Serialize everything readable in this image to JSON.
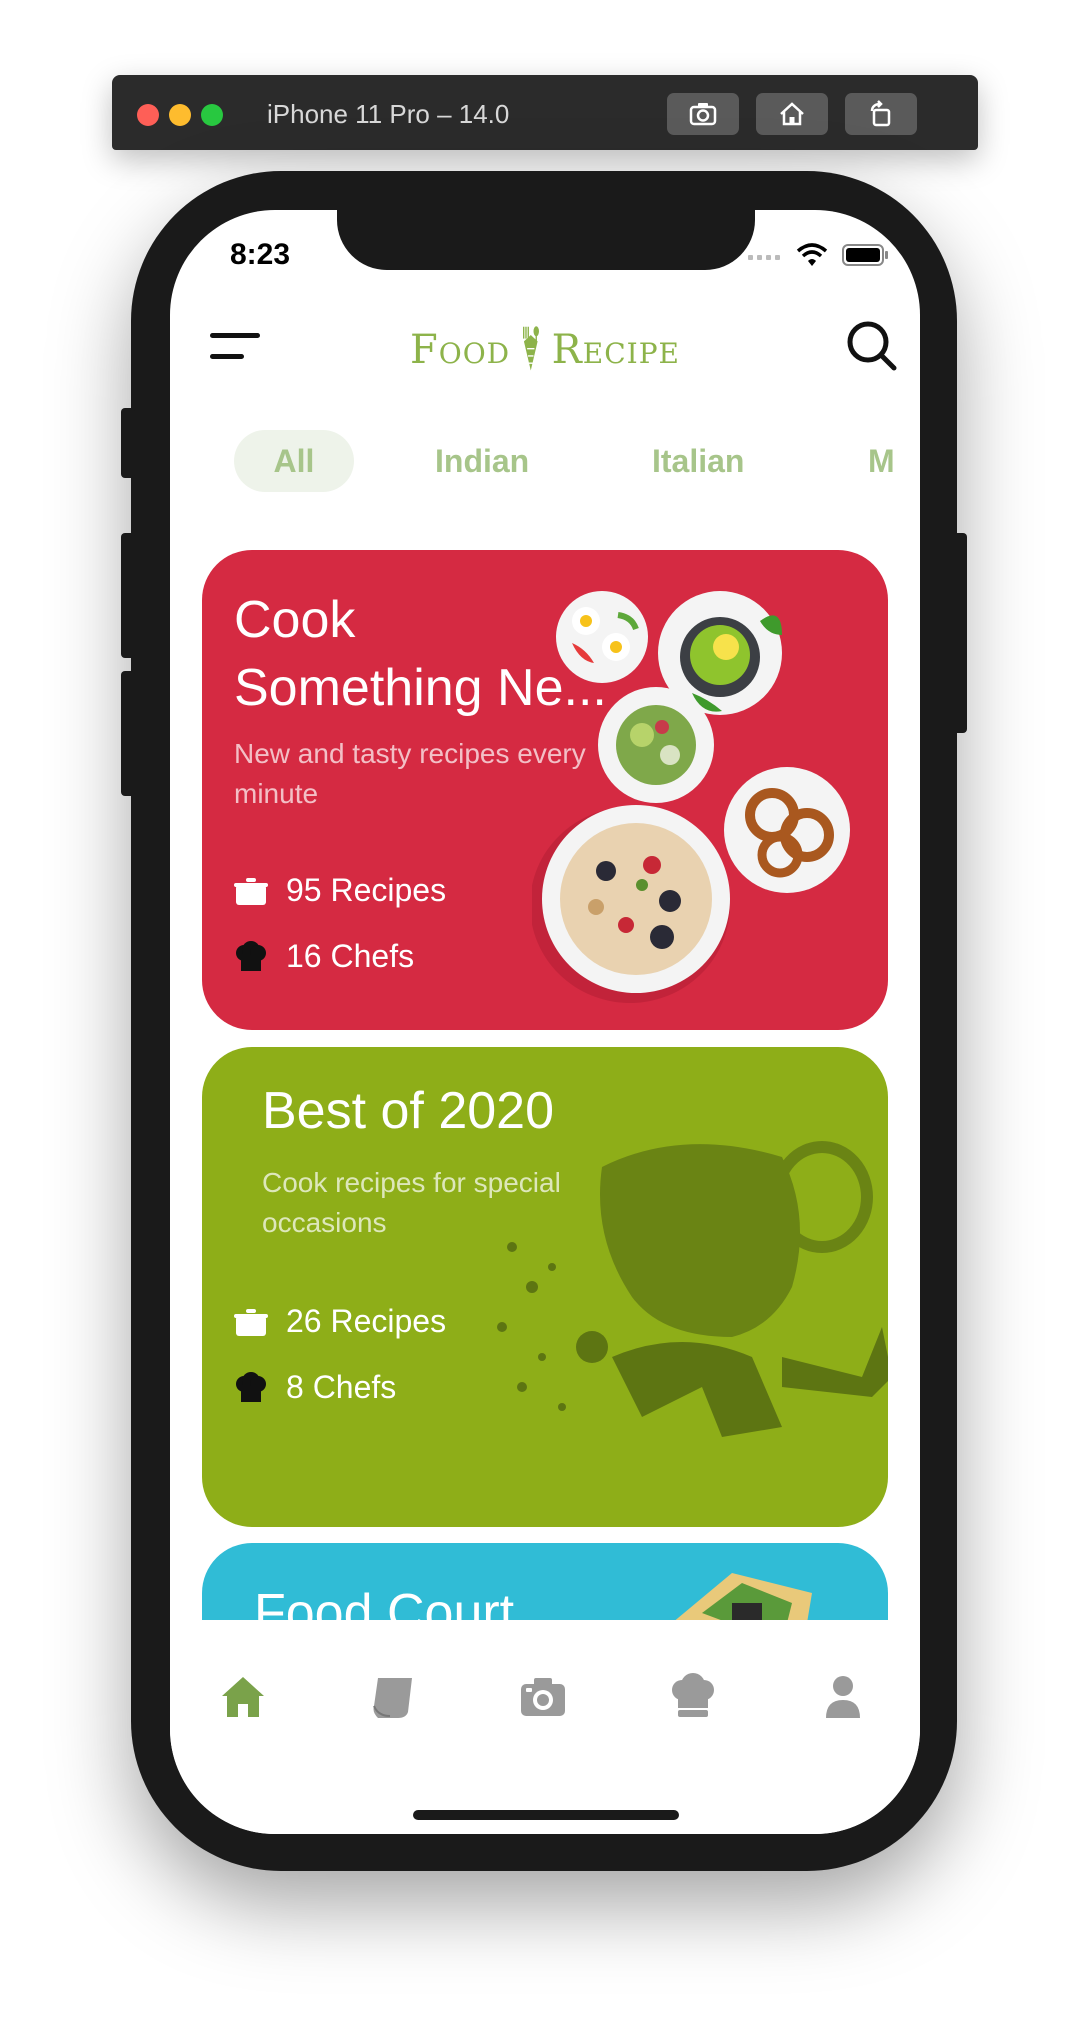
{
  "window": {
    "title": "iPhone 11 Pro – 14.0",
    "buttons": [
      "screenshot-icon",
      "home-icon",
      "rotate-icon"
    ]
  },
  "status": {
    "time": "8:23"
  },
  "header": {
    "logo_left": "Food",
    "logo_right": "Recipe"
  },
  "categories": [
    {
      "label": "All",
      "active": true
    },
    {
      "label": "Indian",
      "active": false
    },
    {
      "label": "Italian",
      "active": false
    },
    {
      "label": "M",
      "active": false
    }
  ],
  "cards": [
    {
      "title_line1": "Cook",
      "title_line2": "Something Ne...",
      "subtitle": "New and tasty recipes every minute",
      "recipes": "95 Recipes",
      "chefs": "16 Chefs",
      "color": "#d52a42"
    },
    {
      "title_line1": "Best of 2020",
      "subtitle": "Cook recipes for special occasions",
      "recipes": "26 Recipes",
      "chefs": "8 Chefs",
      "color": "#8eae18"
    },
    {
      "title_line1": "Food Court",
      "color": "#30bcd6"
    }
  ],
  "nav": {
    "items": [
      "home-icon",
      "book-icon",
      "camera-icon",
      "chef-hat-icon",
      "profile-icon"
    ],
    "active_color": "#7aa24a",
    "inactive_color": "#9a9a9a"
  }
}
